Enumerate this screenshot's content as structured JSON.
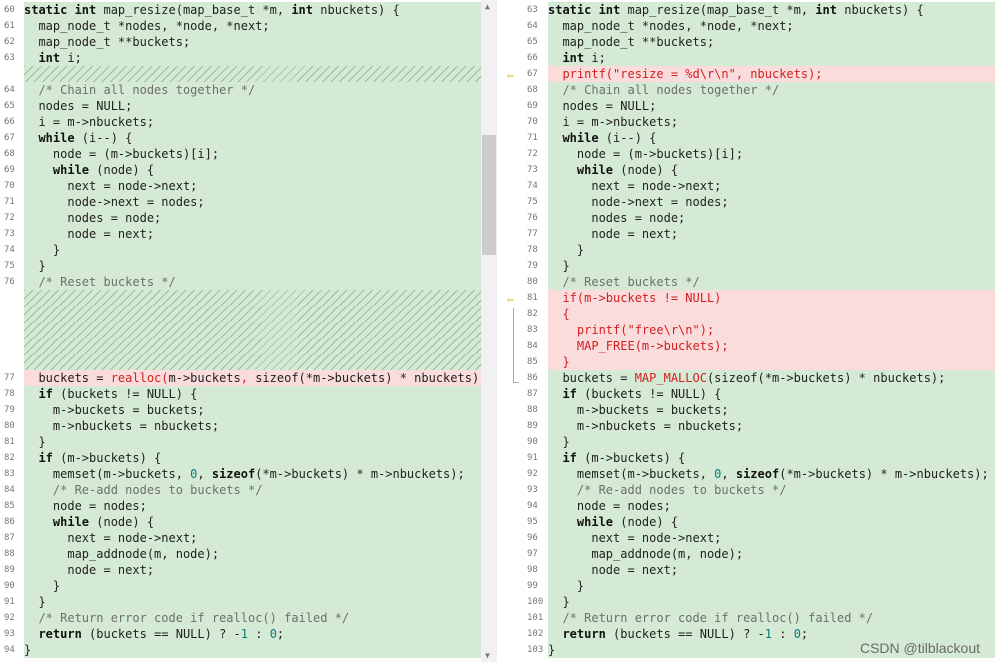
{
  "left": [
    {
      "n": "60",
      "t": "same",
      "html": "<span class=\"kw\">static int</span> map_resize(map_base_t *m, <span class=\"kw\">int</span> nbuckets) {"
    },
    {
      "n": "61",
      "t": "same",
      "html": "  map_node_t *nodes, *node, *next;"
    },
    {
      "n": "62",
      "t": "same",
      "html": "  map_node_t **buckets;"
    },
    {
      "n": "63",
      "t": "same",
      "html": "  <span class=\"kw\">int</span> i;"
    },
    {
      "n": "",
      "t": "filler",
      "html": ""
    },
    {
      "n": "64",
      "t": "same",
      "html": "  <span class=\"cm\">/* Chain all nodes together */</span>"
    },
    {
      "n": "65",
      "t": "same",
      "html": "  nodes = NULL;"
    },
    {
      "n": "66",
      "t": "same",
      "html": "  i = m->nbuckets;"
    },
    {
      "n": "67",
      "t": "same",
      "html": "  <span class=\"kw\">while</span> (i--) {"
    },
    {
      "n": "68",
      "t": "same",
      "html": "    node = (m->buckets)[i];"
    },
    {
      "n": "69",
      "t": "same",
      "html": "    <span class=\"kw\">while</span> (node) {"
    },
    {
      "n": "70",
      "t": "same",
      "html": "      next = node->next;"
    },
    {
      "n": "71",
      "t": "same",
      "html": "      node->next = nodes;"
    },
    {
      "n": "72",
      "t": "same",
      "html": "      nodes = node;"
    },
    {
      "n": "73",
      "t": "same",
      "html": "      node = next;"
    },
    {
      "n": "74",
      "t": "same",
      "html": "    }"
    },
    {
      "n": "75",
      "t": "same",
      "html": "  }"
    },
    {
      "n": "76",
      "t": "same",
      "html": "  <span class=\"cm\">/* Reset buckets */</span>"
    },
    {
      "n": "",
      "t": "filler",
      "html": ""
    },
    {
      "n": "",
      "t": "filler",
      "html": ""
    },
    {
      "n": "",
      "t": "filler",
      "html": ""
    },
    {
      "n": "",
      "t": "filler",
      "html": ""
    },
    {
      "n": "",
      "t": "filler",
      "html": ""
    },
    {
      "n": "77",
      "t": "changed",
      "html": "  buckets = <span class=\"red\">realloc(</span>m->buckets<span class=\"red\">,</span> sizeof(*m->buckets) * nbuckets);"
    },
    {
      "n": "78",
      "t": "same",
      "html": "  <span class=\"kw\">if</span> (buckets != NULL) {"
    },
    {
      "n": "79",
      "t": "same",
      "html": "    m->buckets = buckets;"
    },
    {
      "n": "80",
      "t": "same",
      "html": "    m->nbuckets = nbuckets;"
    },
    {
      "n": "81",
      "t": "same",
      "html": "  }"
    },
    {
      "n": "82",
      "t": "same",
      "html": "  <span class=\"kw\">if</span> (m->buckets) {"
    },
    {
      "n": "83",
      "t": "same",
      "html": "    memset(m->buckets, <span class=\"num\">0</span>, <span class=\"kw\">sizeof</span>(*m->buckets) * m->nbuckets);"
    },
    {
      "n": "84",
      "t": "same",
      "html": "    <span class=\"cm\">/* Re-add nodes to buckets */</span>"
    },
    {
      "n": "85",
      "t": "same",
      "html": "    node = nodes;"
    },
    {
      "n": "86",
      "t": "same",
      "html": "    <span class=\"kw\">while</span> (node) {"
    },
    {
      "n": "87",
      "t": "same",
      "html": "      next = node->next;"
    },
    {
      "n": "88",
      "t": "same",
      "html": "      map_addnode(m, node);"
    },
    {
      "n": "89",
      "t": "same",
      "html": "      node = next;"
    },
    {
      "n": "90",
      "t": "same",
      "html": "    }"
    },
    {
      "n": "91",
      "t": "same",
      "html": "  }"
    },
    {
      "n": "92",
      "t": "same",
      "html": "  <span class=\"cm\">/* Return error code if realloc() failed */</span>"
    },
    {
      "n": "93",
      "t": "same",
      "html": "  <span class=\"kw\">return</span> (buckets == NULL) ? -<span class=\"num\">1</span> : <span class=\"num\">0</span>;"
    },
    {
      "n": "94",
      "t": "same",
      "html": "}"
    }
  ],
  "right": [
    {
      "n": "63",
      "t": "same",
      "html": "<span class=\"kw\">static int</span> map_resize(map_base_t *m, <span class=\"kw\">int</span> nbuckets) {"
    },
    {
      "n": "64",
      "t": "same",
      "html": "  map_node_t *nodes, *node, *next;"
    },
    {
      "n": "65",
      "t": "same",
      "html": "  map_node_t **buckets;"
    },
    {
      "n": "66",
      "t": "same",
      "html": "  <span class=\"kw\">int</span> i;"
    },
    {
      "n": "67",
      "t": "changed",
      "html": "<span class=\"red\">  printf(\"resize = %d\\r\\n\", nbuckets);</span>"
    },
    {
      "n": "68",
      "t": "same",
      "html": "  <span class=\"cm\">/* Chain all nodes together */</span>"
    },
    {
      "n": "69",
      "t": "same",
      "html": "  nodes = NULL;"
    },
    {
      "n": "70",
      "t": "same",
      "html": "  i = m->nbuckets;"
    },
    {
      "n": "71",
      "t": "same",
      "html": "  <span class=\"kw\">while</span> (i--) {"
    },
    {
      "n": "72",
      "t": "same",
      "html": "    node = (m->buckets)[i];"
    },
    {
      "n": "73",
      "t": "same",
      "html": "    <span class=\"kw\">while</span> (node) {"
    },
    {
      "n": "74",
      "t": "same",
      "html": "      next = node->next;"
    },
    {
      "n": "75",
      "t": "same",
      "html": "      node->next = nodes;"
    },
    {
      "n": "76",
      "t": "same",
      "html": "      nodes = node;"
    },
    {
      "n": "77",
      "t": "same",
      "html": "      node = next;"
    },
    {
      "n": "78",
      "t": "same",
      "html": "    }"
    },
    {
      "n": "79",
      "t": "same",
      "html": "  }"
    },
    {
      "n": "80",
      "t": "same",
      "html": "  <span class=\"cm\">/* Reset buckets */</span>"
    },
    {
      "n": "81",
      "t": "changed",
      "html": "<span class=\"red\">  if(m->buckets != NULL)</span>"
    },
    {
      "n": "82",
      "t": "changed",
      "html": "<span class=\"red\">  {</span>"
    },
    {
      "n": "83",
      "t": "changed",
      "html": "<span class=\"red\">    printf(\"free\\r\\n\");</span>"
    },
    {
      "n": "84",
      "t": "changed",
      "html": "<span class=\"red\">    MAP_FREE(m->buckets);</span>"
    },
    {
      "n": "85",
      "t": "changed",
      "html": "<span class=\"red\">  }</span>"
    },
    {
      "n": "86",
      "t": "same",
      "html": "  buckets = <span class=\"red\">MAP_MALLOC</span>(sizeof(*m->buckets) * nbuckets);"
    },
    {
      "n": "87",
      "t": "same",
      "html": "  <span class=\"kw\">if</span> (buckets != NULL) {"
    },
    {
      "n": "88",
      "t": "same",
      "html": "    m->buckets = buckets;"
    },
    {
      "n": "89",
      "t": "same",
      "html": "    m->nbuckets = nbuckets;"
    },
    {
      "n": "90",
      "t": "same",
      "html": "  }"
    },
    {
      "n": "91",
      "t": "same",
      "html": "  <span class=\"kw\">if</span> (m->buckets) {"
    },
    {
      "n": "92",
      "t": "same",
      "html": "    memset(m->buckets, <span class=\"num\">0</span>, <span class=\"kw\">sizeof</span>(*m->buckets) * m->nbuckets);"
    },
    {
      "n": "93",
      "t": "same",
      "html": "    <span class=\"cm\">/* Re-add nodes to buckets */</span>"
    },
    {
      "n": "94",
      "t": "same",
      "html": "    node = nodes;"
    },
    {
      "n": "95",
      "t": "same",
      "html": "    <span class=\"kw\">while</span> (node) {"
    },
    {
      "n": "96",
      "t": "same",
      "html": "      next = node->next;"
    },
    {
      "n": "97",
      "t": "same",
      "html": "      map_addnode(m, node);"
    },
    {
      "n": "98",
      "t": "same",
      "html": "      node = next;"
    },
    {
      "n": "99",
      "t": "same",
      "html": "    }"
    },
    {
      "n": "100",
      "t": "same",
      "html": "  }"
    },
    {
      "n": "101",
      "t": "same",
      "html": "  <span class=\"cm\">/* Return error code if realloc() failed */</span>"
    },
    {
      "n": "102",
      "t": "same",
      "html": "  <span class=\"kw\">return</span> (buckets == NULL) ? -<span class=\"num\">1</span> : <span class=\"num\">0</span>;"
    },
    {
      "n": "103",
      "t": "same",
      "html": "}"
    }
  ],
  "markers": {
    "icon": "arrow-left-icon",
    "glyph": "⇦"
  },
  "scrollbar": {
    "up": "▲",
    "down": "▼"
  },
  "watermark": "CSDN @tilblackout"
}
